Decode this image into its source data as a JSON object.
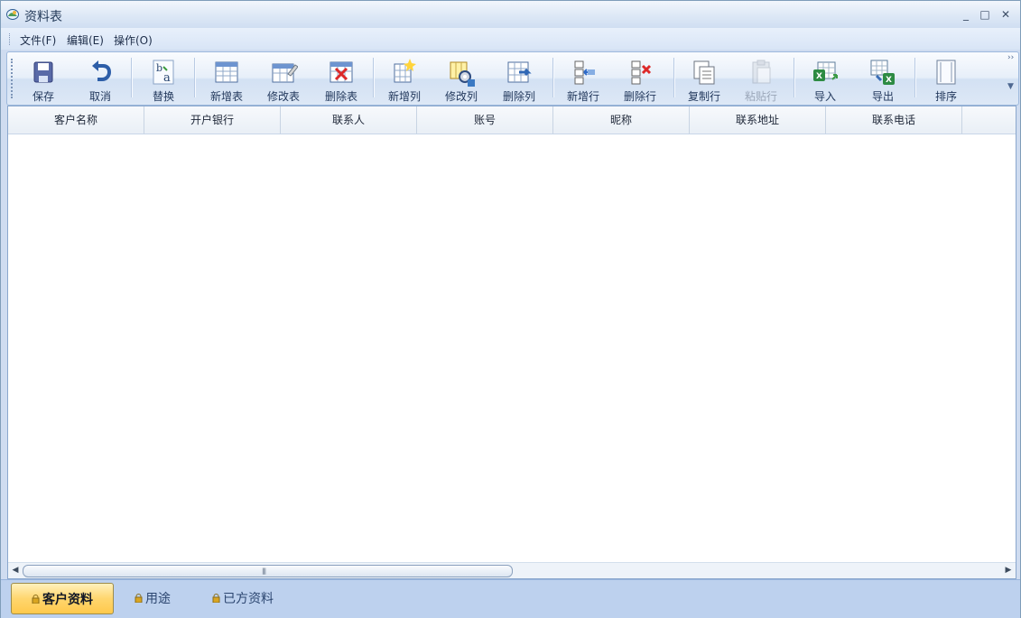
{
  "window": {
    "title": "资料表"
  },
  "menu": {
    "items": [
      {
        "label": "文件(F)"
      },
      {
        "label": "编辑(E)"
      },
      {
        "label": "操作(O)"
      }
    ]
  },
  "toolbar": {
    "buttons": [
      {
        "label": "保存",
        "icon": "save-icon"
      },
      {
        "label": "取消",
        "icon": "undo-icon"
      },
      {
        "label": "替换",
        "icon": "replace-icon"
      },
      {
        "label": "新增表",
        "icon": "table-new-icon"
      },
      {
        "label": "修改表",
        "icon": "table-edit-icon"
      },
      {
        "label": "删除表",
        "icon": "table-delete-icon"
      },
      {
        "label": "新增列",
        "icon": "column-add-icon"
      },
      {
        "label": "修改列",
        "icon": "column-edit-icon"
      },
      {
        "label": "删除列",
        "icon": "column-delete-icon"
      },
      {
        "label": "新增行",
        "icon": "row-add-icon"
      },
      {
        "label": "删除行",
        "icon": "row-delete-icon"
      },
      {
        "label": "复制行",
        "icon": "copy-row-icon"
      },
      {
        "label": "粘贴行",
        "icon": "paste-row-icon",
        "disabled": true
      },
      {
        "label": "导入",
        "icon": "excel-import-icon"
      },
      {
        "label": "导出",
        "icon": "excel-export-icon"
      },
      {
        "label": "排序",
        "icon": "sort-icon"
      }
    ]
  },
  "table": {
    "columns": [
      {
        "label": "客户名称"
      },
      {
        "label": "开户银行"
      },
      {
        "label": "联系人"
      },
      {
        "label": "账号"
      },
      {
        "label": "昵称"
      },
      {
        "label": "联系地址"
      },
      {
        "label": "联系电话"
      }
    ],
    "rows": []
  },
  "bottom_tabs": [
    {
      "label": "客户资料",
      "active": true
    },
    {
      "label": "用途"
    },
    {
      "label": "已方资料"
    }
  ],
  "colors": {
    "accent": "#ffd66e",
    "window_blue": "#cfdcf0",
    "border": "#8aa7cd"
  }
}
